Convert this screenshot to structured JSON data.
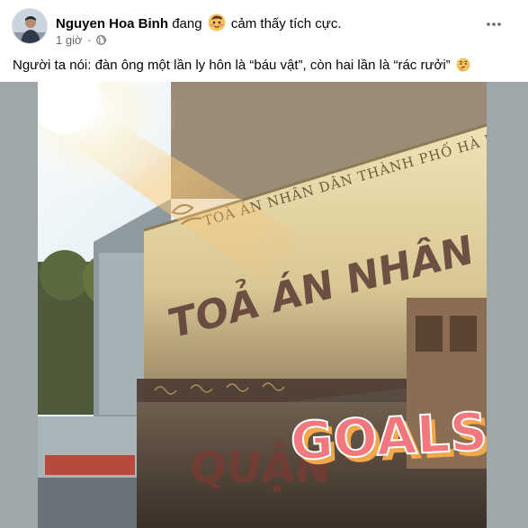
{
  "post": {
    "author_name": "Nguyen Hoa Binh",
    "feeling_prefix": "đang",
    "feeling_emoji": "blushing-face-icon",
    "feeling_text": "cảm thấy tích cực.",
    "time": "1 giờ",
    "separator": "·",
    "privacy_icon": "globe-icon",
    "more_icon": "more-dots-icon",
    "caption_text": "Người ta nói: đàn ông một lần ly hôn là “báu vật”, còn hai lần là “rác rưởi”",
    "caption_emoji": "thinking-face-icon"
  },
  "photo": {
    "sign_top_line": "TOÀ ÁN NHÂN DÂN THÀNH PHỐ HÀ NỘI",
    "sign_main_line": "TOẢ ÁN NHÂN DÂN",
    "sign_district": "QUẬN",
    "sticker_text": "GOALS"
  },
  "colors": {
    "author_text": "#050505",
    "meta_text": "#65676b",
    "frame_background": "#9fa8a8",
    "sticker_fill": "#f2787d",
    "sticker_shadow": "#f0a84a"
  }
}
